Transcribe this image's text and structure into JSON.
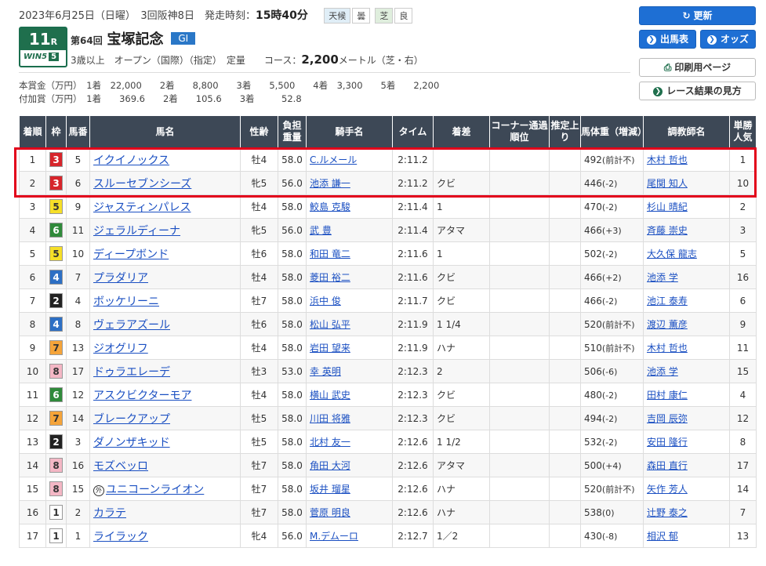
{
  "header": {
    "date_info": "2023年6月25日（日曜）　3回阪神8日　発走時刻：",
    "post_time": "15時40分",
    "weather_label": "天候",
    "weather": "曇",
    "track_type": "芝",
    "track_condition": "良"
  },
  "race": {
    "number": "11",
    "r_suffix": "R",
    "win5_label": "WIN5",
    "win5_num": "5",
    "kai": "第64回",
    "name": "宝塚記念",
    "grade": "GI",
    "conditions": "3歳以上　オープン（国際）（指定）　定量　　コース：",
    "distance": "2,200",
    "distance_unit": "メートル（芝・右）"
  },
  "prize": {
    "main": "本賞金（万円）　1着　22,000　　2着　　8,800　　3着　　5,500　　4着　3,300　　5着　　2,200",
    "extra": "付加賞（万円）　1着　　369.6　　2着　　105.6　　3着　　　52.8"
  },
  "buttons": {
    "refresh": "更新",
    "entries": "出馬表",
    "odds": "オッズ",
    "print": "印刷用ページ",
    "guide": "レース結果の見方"
  },
  "icons": {
    "refresh": "refresh-icon",
    "entries": "arrow-circle-icon",
    "odds": "arrow-circle-icon",
    "print": "printer-icon",
    "guide": "arrow-circle-icon"
  },
  "colors": {
    "header_bg": "#3d4856",
    "race_green": "#1f6f4d",
    "button_blue": "#1e6fd4",
    "grade_blue": "#2a77c7",
    "highlight_red": "#e2001a",
    "link": "#1a4fc2"
  },
  "table": {
    "headers": [
      "着順",
      "枠",
      "馬番",
      "馬名",
      "性齢",
      "負担重量",
      "騎手名",
      "タイム",
      "着差",
      "コーナー通過順位",
      "推定上り",
      "馬体重（増減）",
      "調教師名",
      "単勝人気"
    ],
    "rows": [
      {
        "pos": "1",
        "waku": "3",
        "num": "5",
        "foreign": "",
        "horse": "イクイノックス",
        "sexage": "牡4",
        "weight": "58.0",
        "jockey": "C.ルメール",
        "time": "2:11.2",
        "margin": "",
        "corner": "",
        "agari": "",
        "bw": "492",
        "bwd": "(前計不)",
        "trainer": "木村 哲也",
        "pop": "1"
      },
      {
        "pos": "2",
        "waku": "3",
        "num": "6",
        "foreign": "",
        "horse": "スルーセブンシーズ",
        "sexage": "牝5",
        "weight": "56.0",
        "jockey": "池添 謙一",
        "time": "2:11.2",
        "margin": "クビ",
        "corner": "",
        "agari": "",
        "bw": "446",
        "bwd": "(-2)",
        "trainer": "尾関 知人",
        "pop": "10"
      },
      {
        "pos": "3",
        "waku": "5",
        "num": "9",
        "foreign": "",
        "horse": "ジャスティンパレス",
        "sexage": "牡4",
        "weight": "58.0",
        "jockey": "鮫島 克駿",
        "time": "2:11.4",
        "margin": "1",
        "corner": "",
        "agari": "",
        "bw": "470",
        "bwd": "(-2)",
        "trainer": "杉山 晴紀",
        "pop": "2"
      },
      {
        "pos": "4",
        "waku": "6",
        "num": "11",
        "foreign": "",
        "horse": "ジェラルディーナ",
        "sexage": "牝5",
        "weight": "56.0",
        "jockey": "武 豊",
        "time": "2:11.4",
        "margin": "アタマ",
        "corner": "",
        "agari": "",
        "bw": "466",
        "bwd": "(+3)",
        "trainer": "斉藤 崇史",
        "pop": "3"
      },
      {
        "pos": "5",
        "waku": "5",
        "num": "10",
        "foreign": "",
        "horse": "ディープボンド",
        "sexage": "牡6",
        "weight": "58.0",
        "jockey": "和田 竜二",
        "time": "2:11.6",
        "margin": "1",
        "corner": "",
        "agari": "",
        "bw": "502",
        "bwd": "(-2)",
        "trainer": "大久保 龍志",
        "pop": "5"
      },
      {
        "pos": "6",
        "waku": "4",
        "num": "7",
        "foreign": "",
        "horse": "プラダリア",
        "sexage": "牡4",
        "weight": "58.0",
        "jockey": "菱田 裕二",
        "time": "2:11.6",
        "margin": "クビ",
        "corner": "",
        "agari": "",
        "bw": "466",
        "bwd": "(+2)",
        "trainer": "池添 学",
        "pop": "16"
      },
      {
        "pos": "7",
        "waku": "2",
        "num": "4",
        "foreign": "",
        "horse": "ボッケリーニ",
        "sexage": "牡7",
        "weight": "58.0",
        "jockey": "浜中 俊",
        "time": "2:11.7",
        "margin": "クビ",
        "corner": "",
        "agari": "",
        "bw": "466",
        "bwd": "(-2)",
        "trainer": "池江 泰寿",
        "pop": "6"
      },
      {
        "pos": "8",
        "waku": "4",
        "num": "8",
        "foreign": "",
        "horse": "ヴェラアズール",
        "sexage": "牡6",
        "weight": "58.0",
        "jockey": "松山 弘平",
        "time": "2:11.9",
        "margin": "1 1/4",
        "corner": "",
        "agari": "",
        "bw": "520",
        "bwd": "(前計不)",
        "trainer": "渡辺 薫彦",
        "pop": "9"
      },
      {
        "pos": "9",
        "waku": "7",
        "num": "13",
        "foreign": "",
        "horse": "ジオグリフ",
        "sexage": "牡4",
        "weight": "58.0",
        "jockey": "岩田 望来",
        "time": "2:11.9",
        "margin": "ハナ",
        "corner": "",
        "agari": "",
        "bw": "510",
        "bwd": "(前計不)",
        "trainer": "木村 哲也",
        "pop": "11"
      },
      {
        "pos": "10",
        "waku": "8",
        "num": "17",
        "foreign": "",
        "horse": "ドゥラエレーデ",
        "sexage": "牡3",
        "weight": "53.0",
        "jockey": "幸 英明",
        "time": "2:12.3",
        "margin": "2",
        "corner": "",
        "agari": "",
        "bw": "506",
        "bwd": "(-6)",
        "trainer": "池添 学",
        "pop": "15"
      },
      {
        "pos": "11",
        "waku": "6",
        "num": "12",
        "foreign": "",
        "horse": "アスクビクターモア",
        "sexage": "牡4",
        "weight": "58.0",
        "jockey": "横山 武史",
        "time": "2:12.3",
        "margin": "クビ",
        "corner": "",
        "agari": "",
        "bw": "480",
        "bwd": "(-2)",
        "trainer": "田村 康仁",
        "pop": "4"
      },
      {
        "pos": "12",
        "waku": "7",
        "num": "14",
        "foreign": "",
        "horse": "ブレークアップ",
        "sexage": "牡5",
        "weight": "58.0",
        "jockey": "川田 将雅",
        "time": "2:12.3",
        "margin": "クビ",
        "corner": "",
        "agari": "",
        "bw": "494",
        "bwd": "(-2)",
        "trainer": "吉岡 辰弥",
        "pop": "12"
      },
      {
        "pos": "13",
        "waku": "2",
        "num": "3",
        "foreign": "",
        "horse": "ダノンザキッド",
        "sexage": "牡5",
        "weight": "58.0",
        "jockey": "北村 友一",
        "time": "2:12.6",
        "margin": "1 1/2",
        "corner": "",
        "agari": "",
        "bw": "532",
        "bwd": "(-2)",
        "trainer": "安田 隆行",
        "pop": "8"
      },
      {
        "pos": "14",
        "waku": "8",
        "num": "16",
        "foreign": "",
        "horse": "モズベッロ",
        "sexage": "牡7",
        "weight": "58.0",
        "jockey": "角田 大河",
        "time": "2:12.6",
        "margin": "アタマ",
        "corner": "",
        "agari": "",
        "bw": "500",
        "bwd": "(+4)",
        "trainer": "森田 直行",
        "pop": "17"
      },
      {
        "pos": "15",
        "waku": "8",
        "num": "15",
        "foreign": "外",
        "horse": "ユニコーンライオン",
        "sexage": "牡7",
        "weight": "58.0",
        "jockey": "坂井 瑠星",
        "time": "2:12.6",
        "margin": "ハナ",
        "corner": "",
        "agari": "",
        "bw": "520",
        "bwd": "(前計不)",
        "trainer": "矢作 芳人",
        "pop": "14"
      },
      {
        "pos": "16",
        "waku": "1",
        "num": "2",
        "foreign": "",
        "horse": "カラテ",
        "sexage": "牡7",
        "weight": "58.0",
        "jockey": "菅原 明良",
        "time": "2:12.6",
        "margin": "ハナ",
        "corner": "",
        "agari": "",
        "bw": "538",
        "bwd": "(0)",
        "trainer": "辻野 泰之",
        "pop": "7"
      },
      {
        "pos": "17",
        "waku": "1",
        "num": "1",
        "foreign": "",
        "horse": "ライラック",
        "sexage": "牝4",
        "weight": "56.0",
        "jockey": "M.デムーロ",
        "time": "2:12.7",
        "margin": "1／2",
        "corner": "",
        "agari": "",
        "bw": "430",
        "bwd": "(-8)",
        "trainer": "相沢 郁",
        "pop": "13"
      }
    ]
  },
  "waku_colors": {
    "1": {
      "bg": "#ffffff",
      "fg": "#333333"
    },
    "2": {
      "bg": "#222222",
      "fg": "#ffffff"
    },
    "3": {
      "bg": "#d7252b",
      "fg": "#ffffff"
    },
    "4": {
      "bg": "#2d6fc4",
      "fg": "#ffffff"
    },
    "5": {
      "bg": "#f6df28",
      "fg": "#333333"
    },
    "6": {
      "bg": "#2f8a3a",
      "fg": "#ffffff"
    },
    "7": {
      "bg": "#f5a43a",
      "fg": "#333333"
    },
    "8": {
      "bg": "#f4b7c5",
      "fg": "#333333"
    }
  }
}
